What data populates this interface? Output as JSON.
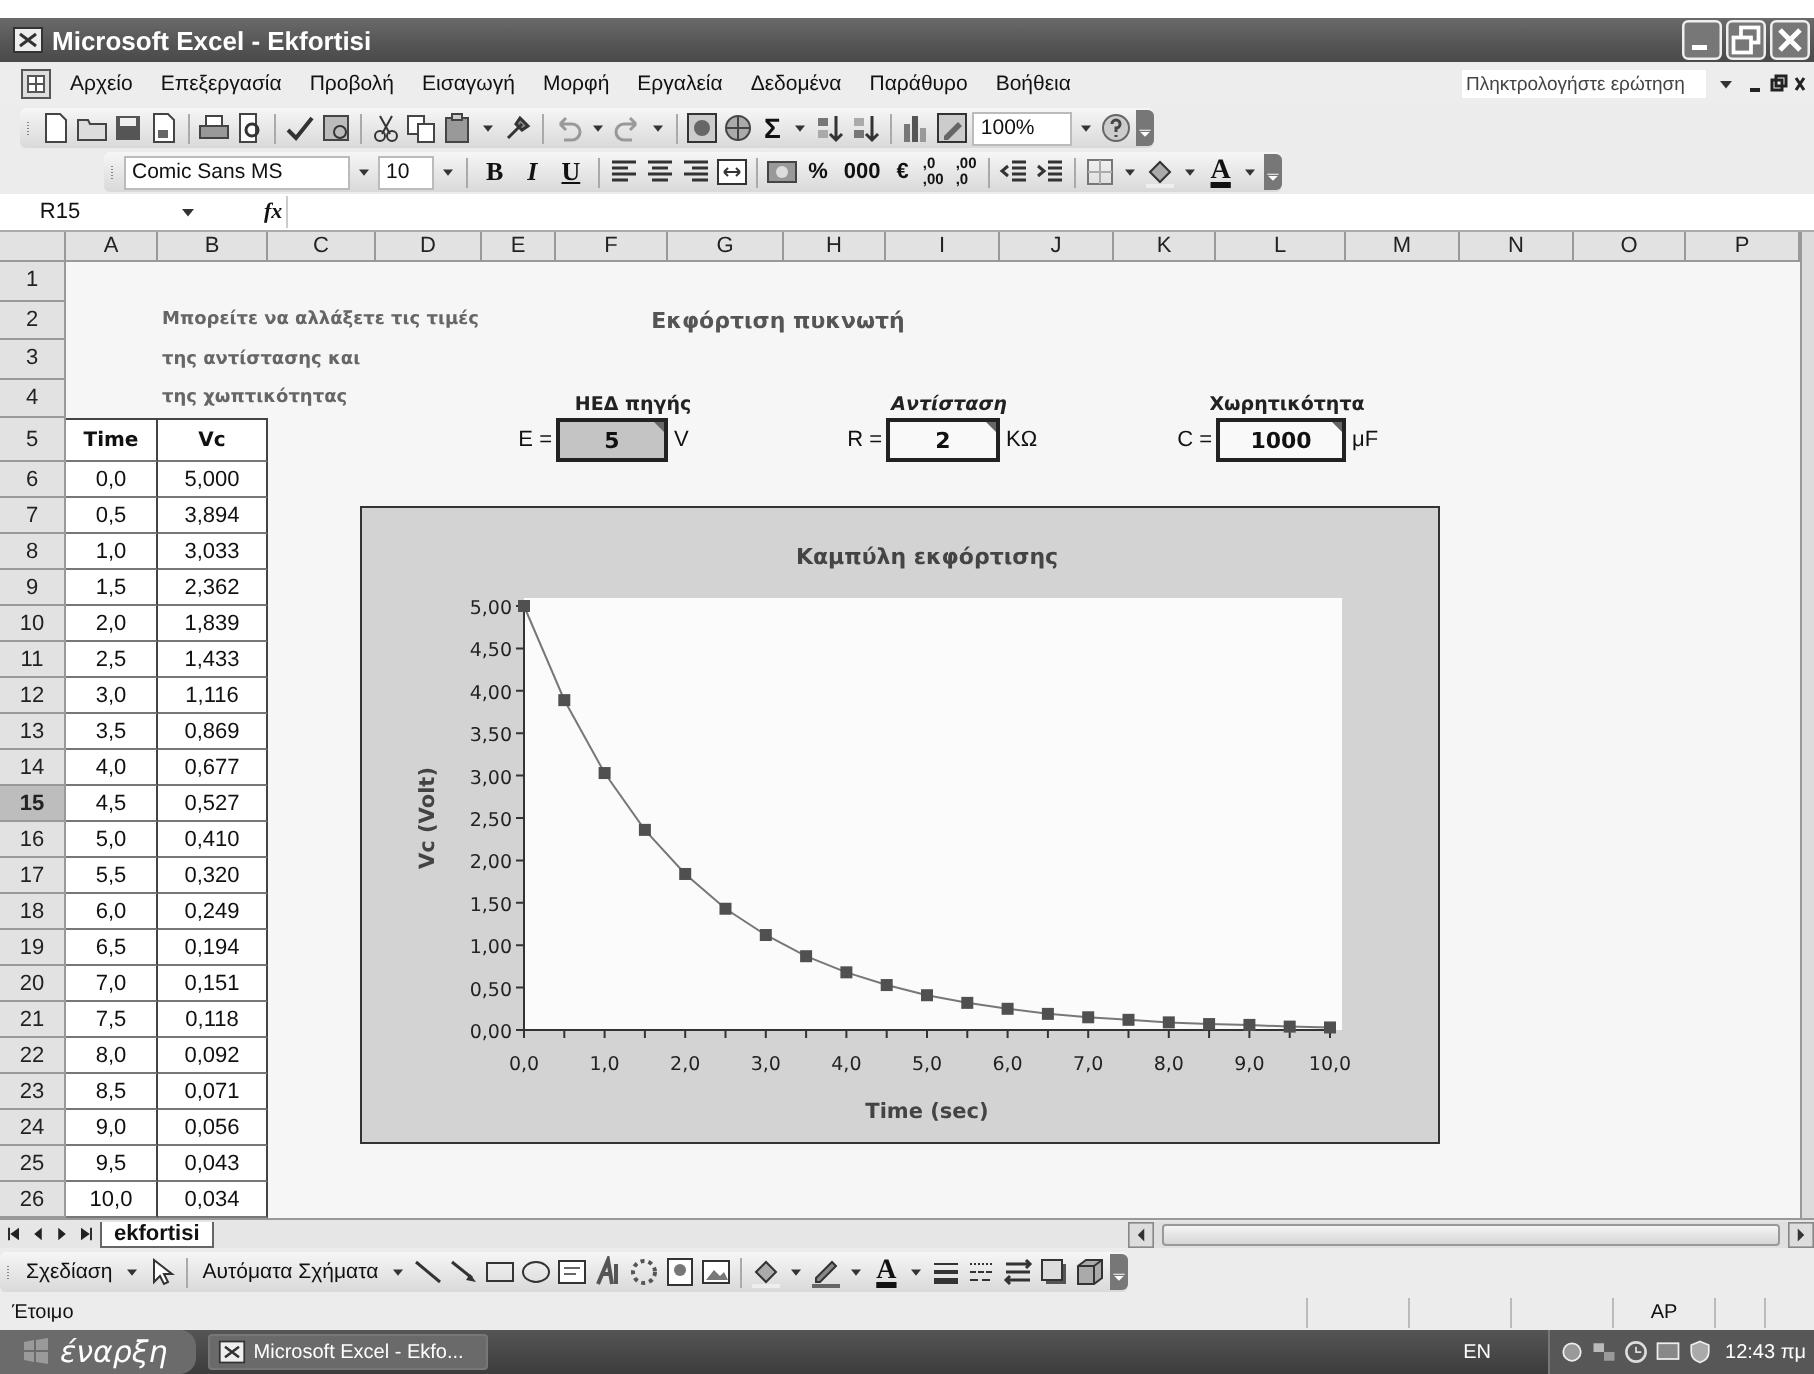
{
  "window": {
    "title": "Microsoft Excel - Ekfortisi"
  },
  "menu": [
    "Αρχείο",
    "Επεξεργασία",
    "Προβολή",
    "Εισαγωγή",
    "Μορφή",
    "Εργαλεία",
    "Δεδομένα",
    "Παράθυρο",
    "Βοήθεια"
  ],
  "help_box": {
    "placeholder": "Πληκτρολογήστε ερώτηση"
  },
  "standard_toolbar": {
    "sum": "Σ",
    "zoom": "100%"
  },
  "formatting_toolbar": {
    "font": "Comic Sans MS",
    "size": "10",
    "style_buttons": [
      "B",
      "I",
      "U"
    ],
    "number_buttons": [
      "%",
      "000",
      "€"
    ],
    "decimal_buttons": [
      [
        ",0",
        ",00"
      ],
      [
        ",00",
        ",0"
      ]
    ],
    "font_color": "A"
  },
  "formula_bar": {
    "name_box": "R15",
    "function_label": "fx"
  },
  "sheet": {
    "column_headers": [
      "A",
      "B",
      "C",
      "D",
      "E",
      "F",
      "G",
      "H",
      "I",
      "J",
      "K",
      "L",
      "M",
      "N",
      "O",
      "P"
    ],
    "row_headers": [
      {
        "label": "1",
        "selected": false
      },
      {
        "label": "2",
        "selected": false
      },
      {
        "label": "3",
        "selected": false
      },
      {
        "label": "4",
        "selected": false
      },
      {
        "label": "5",
        "selected": false
      },
      {
        "label": "6",
        "selected": false
      },
      {
        "label": "7",
        "selected": false
      },
      {
        "label": "8",
        "selected": false
      },
      {
        "label": "9",
        "selected": false
      },
      {
        "label": "10",
        "selected": false
      },
      {
        "label": "11",
        "selected": false
      },
      {
        "label": "12",
        "selected": false
      },
      {
        "label": "13",
        "selected": false
      },
      {
        "label": "14",
        "selected": false
      },
      {
        "label": "15",
        "selected": true
      },
      {
        "label": "16",
        "selected": false
      },
      {
        "label": "17",
        "selected": false
      },
      {
        "label": "18",
        "selected": false
      },
      {
        "label": "19",
        "selected": false
      },
      {
        "label": "20",
        "selected": false
      },
      {
        "label": "21",
        "selected": false
      },
      {
        "label": "22",
        "selected": false
      },
      {
        "label": "23",
        "selected": false
      },
      {
        "label": "24",
        "selected": false
      },
      {
        "label": "25",
        "selected": false
      },
      {
        "label": "26",
        "selected": false
      }
    ],
    "note": [
      "Μπορείτε να αλλάξετε τις τιμές",
      "της αντίστασης και",
      "της χωπτικότητας"
    ],
    "heading": "Εκφόρτιση πυκνωτή",
    "parameters": [
      {
        "label": "ΗΕΔ πηγής",
        "italic": false,
        "symbol": "E =",
        "value": "5",
        "unit": "V",
        "shaded": true
      },
      {
        "label": "Αντίσταση",
        "italic": true,
        "symbol": "R =",
        "value": "2",
        "unit": "KΩ",
        "shaded": false
      },
      {
        "label": "Χωρητικότητα",
        "italic": false,
        "symbol": "C =",
        "value": "1000",
        "unit": "μF",
        "shaded": false
      }
    ],
    "table": {
      "columns": [
        "Time",
        "Vc"
      ],
      "rows": [
        [
          "0,0",
          "5,000"
        ],
        [
          "0,5",
          "3,894"
        ],
        [
          "1,0",
          "3,033"
        ],
        [
          "1,5",
          "2,362"
        ],
        [
          "2,0",
          "1,839"
        ],
        [
          "2,5",
          "1,433"
        ],
        [
          "3,0",
          "1,116"
        ],
        [
          "3,5",
          "0,869"
        ],
        [
          "4,0",
          "0,677"
        ],
        [
          "4,5",
          "0,527"
        ],
        [
          "5,0",
          "0,410"
        ],
        [
          "5,5",
          "0,320"
        ],
        [
          "6,0",
          "0,249"
        ],
        [
          "6,5",
          "0,194"
        ],
        [
          "7,0",
          "0,151"
        ],
        [
          "7,5",
          "0,118"
        ],
        [
          "8,0",
          "0,092"
        ],
        [
          "8,5",
          "0,071"
        ],
        [
          "9,0",
          "0,056"
        ],
        [
          "9,5",
          "0,043"
        ],
        [
          "10,0",
          "0,034"
        ]
      ]
    },
    "chart": {
      "chart_data": {
        "type": "line",
        "title": "Καμπύλη εκφόρτισης",
        "xlabel": "Time (sec)",
        "ylabel": "Vc (Volt)",
        "x": [
          0,
          0.5,
          1,
          1.5,
          2,
          2.5,
          3,
          3.5,
          4,
          4.5,
          5,
          5.5,
          6,
          6.5,
          7,
          7.5,
          8,
          8.5,
          9,
          9.5,
          10
        ],
        "series": [
          {
            "color": "#505050",
            "marker": "square",
            "values": [
              5.0,
              3.89,
              3.03,
              2.36,
              1.84,
              1.43,
              1.12,
              0.87,
              0.68,
              0.53,
              0.41,
              0.32,
              0.25,
              0.19,
              0.15,
              0.12,
              0.09,
              0.07,
              0.06,
              0.04,
              0.03
            ]
          }
        ],
        "xlim": [
          0,
          10
        ],
        "ylim": [
          0,
          5
        ],
        "xticks": [
          {
            "value": 0,
            "label": "0,0"
          },
          {
            "value": 1,
            "label": "1,0"
          },
          {
            "value": 2,
            "label": "2,0"
          },
          {
            "value": 3,
            "label": "3,0"
          },
          {
            "value": 4,
            "label": "4,0"
          },
          {
            "value": 5,
            "label": "5,0"
          },
          {
            "value": 6,
            "label": "6,0"
          },
          {
            "value": 7,
            "label": "7,0"
          },
          {
            "value": 8,
            "label": "8,0"
          },
          {
            "value": 9,
            "label": "9,0"
          },
          {
            "value": 10,
            "label": "10,0"
          }
        ],
        "yticks": [
          {
            "value": 0,
            "label": "0,00"
          },
          {
            "value": 0.5,
            "label": "0,50"
          },
          {
            "value": 1,
            "label": "1,00"
          },
          {
            "value": 1.5,
            "label": "1,50"
          },
          {
            "value": 2,
            "label": "2,00"
          },
          {
            "value": 2.5,
            "label": "2,50"
          },
          {
            "value": 3,
            "label": "3,00"
          },
          {
            "value": 3.5,
            "label": "3,50"
          },
          {
            "value": 4,
            "label": "4,00"
          },
          {
            "value": 4.5,
            "label": "4,50"
          },
          {
            "value": 5,
            "label": "5,00"
          }
        ]
      }
    }
  },
  "sheet_tabs": [
    {
      "label": "ekfortisi",
      "selected": true
    }
  ],
  "drawing_toolbar": {
    "draw_menu": "Σχεδίαση",
    "autoshapes_menu": "Αυτόματα Σχήματα",
    "font_color": "A"
  },
  "status_bar": {
    "text": "Έτοιμο",
    "indicator": "AP"
  },
  "taskbar": {
    "start": "έναρξη",
    "tasks": [
      {
        "label": "Microsoft Excel - Ekfo...",
        "selected": false
      }
    ],
    "language": "EN",
    "clock": "12:43 πμ"
  }
}
